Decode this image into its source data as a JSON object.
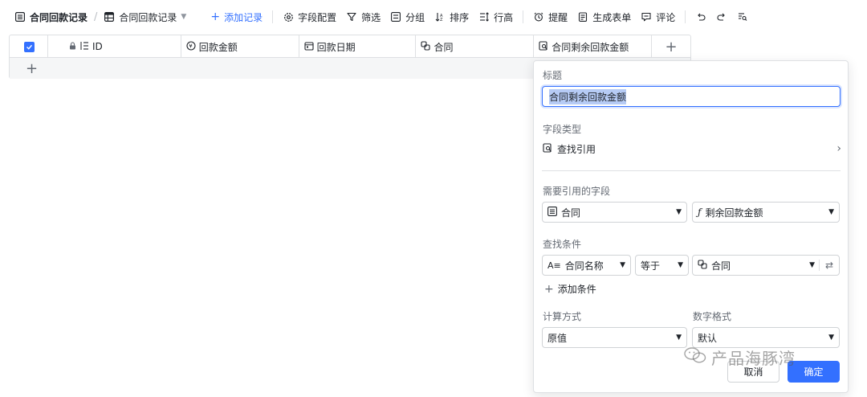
{
  "toolbar": {
    "table_name": "合同回款记录",
    "view_name": "合同回款记录",
    "add_record": "添加记录",
    "field_config": "字段配置",
    "filter": "筛选",
    "group": "分组",
    "sort": "排序",
    "row_height": "行高",
    "reminder": "提醒",
    "generate_form": "生成表单",
    "comment": "评论"
  },
  "grid": {
    "columns": [
      "ID",
      "回款金额",
      "回款日期",
      "合同",
      "合同剩余回款金额"
    ]
  },
  "panel": {
    "title_label": "标题",
    "title_value": "合同剩余回款金额",
    "field_type_label": "字段类型",
    "field_type_value": "查找引用",
    "ref_field_label": "需要引用的字段",
    "ref_table": "合同",
    "ref_field": "剩余回款金额",
    "condition_label": "查找条件",
    "cond_field": "合同名称",
    "cond_op": "等于",
    "cond_value": "合同",
    "add_condition": "添加条件",
    "calc_label": "计算方式",
    "calc_value": "原值",
    "format_label": "数字格式",
    "format_value": "默认",
    "cancel": "取消",
    "confirm": "确定"
  },
  "watermark": {
    "text": "产品海豚湾"
  },
  "colors": {
    "accent": "#3370ff",
    "border": "#dee0e3",
    "muted_text": "#646a73"
  }
}
